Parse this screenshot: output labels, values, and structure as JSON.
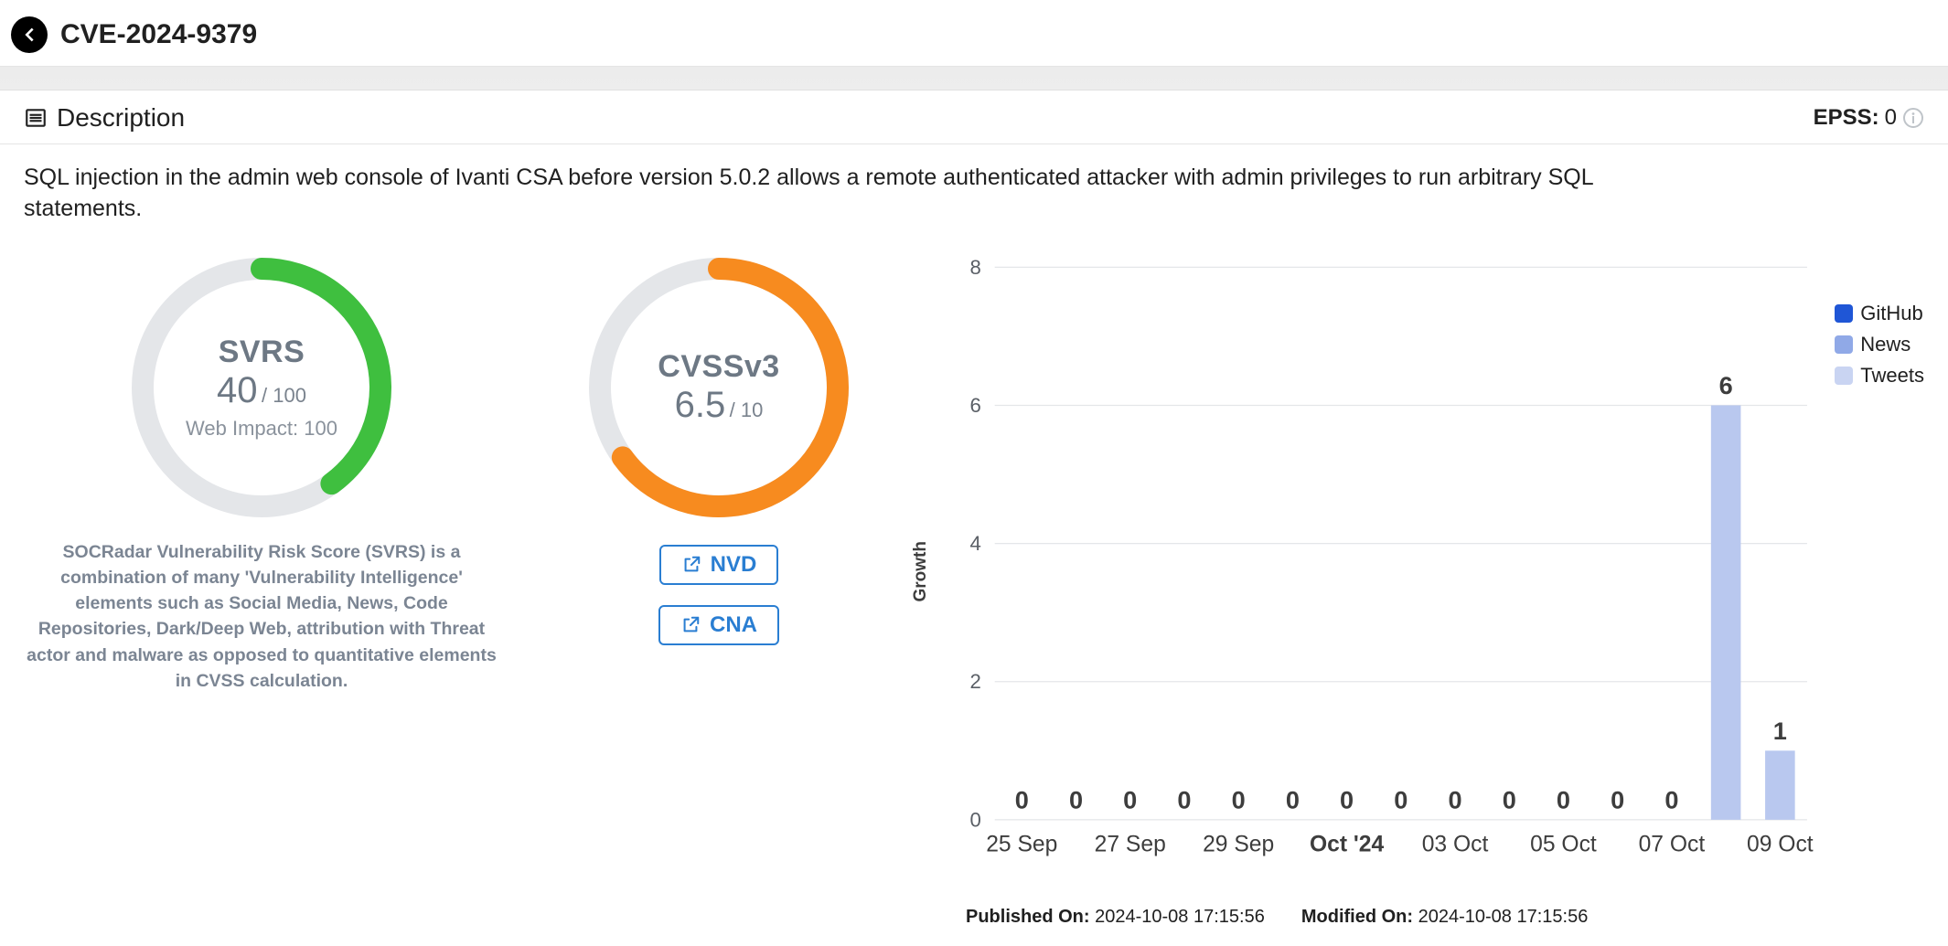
{
  "header": {
    "cve_id": "CVE-2024-9379"
  },
  "section": {
    "title": "Description",
    "epss_label": "EPSS:",
    "epss_value": "0"
  },
  "description_text": "SQL injection in the admin web console of Ivanti CSA before version 5.0.2 allows a remote authenticated attacker with admin privileges to run arbitrary SQL statements.",
  "svrs": {
    "name": "SVRS",
    "value": "40",
    "max": "/ 100",
    "sub": "Web Impact: 100",
    "fraction": 0.4,
    "note": "SOCRadar Vulnerability Risk Score (SVRS) is a combination of many 'Vulnerability Intelligence' elements such as Social Media, News, Code Repositories, Dark/Deep Web, attribution with Threat actor and malware as opposed to quantitative elements in CVSS calculation.",
    "ring_color": "#3fbf3f"
  },
  "cvss": {
    "name": "CVSSv3",
    "value": "6.5",
    "max": "/ 10",
    "fraction": 0.65,
    "ring_color": "#f78b1f"
  },
  "links": {
    "nvd": "NVD",
    "cna": "CNA"
  },
  "chart_data": {
    "type": "bar",
    "title": "",
    "ylabel": "Growth",
    "ylim": [
      0,
      8
    ],
    "yticks": [
      0,
      2,
      4,
      6,
      8
    ],
    "categories": [
      "25 Sep",
      "",
      "27 Sep",
      "",
      "29 Sep",
      "",
      "Oct '24",
      "",
      "03 Oct",
      "",
      "05 Oct",
      "",
      "07 Oct",
      "",
      "09 Oct"
    ],
    "values": [
      0,
      0,
      0,
      0,
      0,
      0,
      0,
      0,
      0,
      0,
      0,
      0,
      0,
      6,
      1
    ],
    "bar_color": "#b9c8ef",
    "data_label_color": "#3d3d3d",
    "legend": [
      {
        "name": "GitHub",
        "color": "#1f56d6"
      },
      {
        "name": "News",
        "color": "#90a9e7"
      },
      {
        "name": "Tweets",
        "color": "#c9d4f2"
      }
    ]
  },
  "meta": {
    "published_label": "Published On:",
    "published_value": "2024-10-08 17:15:56",
    "modified_label": "Modified On:",
    "modified_value": "2024-10-08 17:15:56"
  }
}
